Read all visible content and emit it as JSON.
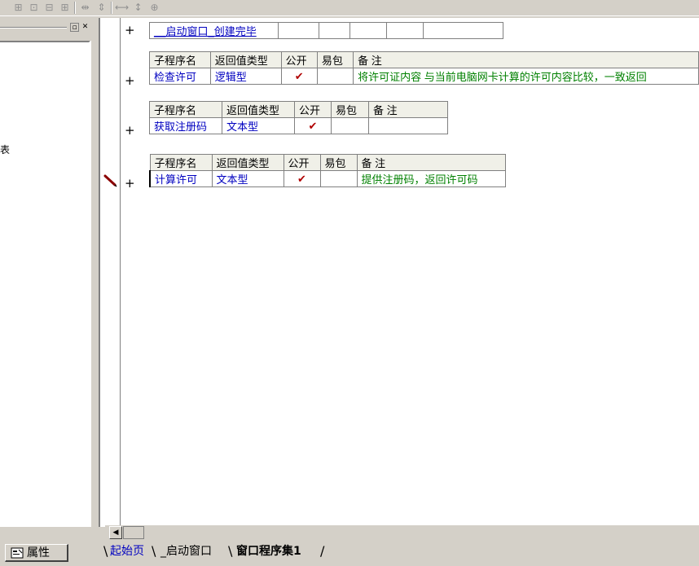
{
  "toolbar": {
    "buttons": [
      "align-left-icon",
      "align-center-icon",
      "align-right-icon",
      "align-bottom-icon",
      "space-horizontal-icon",
      "space-vertical-icon",
      "size-width-icon",
      "size-height-icon",
      "center-icon"
    ]
  },
  "left_panel": {
    "partial_text": "表",
    "properties_tab": "属性"
  },
  "editor": {
    "header_table": {
      "cells": [
        "__启动窗口_创建完毕",
        "",
        "",
        "",
        "",
        ""
      ]
    },
    "subroutines": [
      {
        "headers": [
          "子程序名",
          "返回值类型",
          "公开",
          "易包",
          "备 注"
        ],
        "name": "检查许可",
        "return_type": "逻辑型",
        "public": "✔",
        "easy_package": "",
        "remark": "将许可证内容 与当前电脑网卡计算的许可内容比较，一致返回"
      },
      {
        "headers": [
          "子程序名",
          "返回值类型",
          "公开",
          "易包",
          "备 注"
        ],
        "name": "获取注册码",
        "return_type": "文本型",
        "public": "✔",
        "easy_package": "",
        "remark": ""
      },
      {
        "headers": [
          "子程序名",
          "返回值类型",
          "公开",
          "易包",
          "备 注"
        ],
        "name": "计算许可",
        "return_type": "文本型",
        "public": "✔",
        "easy_package": "",
        "remark": "提供注册码，返回许可码"
      }
    ],
    "plus_symbol": "+"
  },
  "tabs": [
    {
      "label": "起始页",
      "active": false
    },
    {
      "label": "_启动窗口",
      "active": false
    },
    {
      "label": "窗口程序集1",
      "active": true
    }
  ],
  "colors": {
    "link_blue": "#0000c0",
    "remark_green": "#008000",
    "check_red": "#b00000",
    "header_bg": "#f0f0e8"
  }
}
